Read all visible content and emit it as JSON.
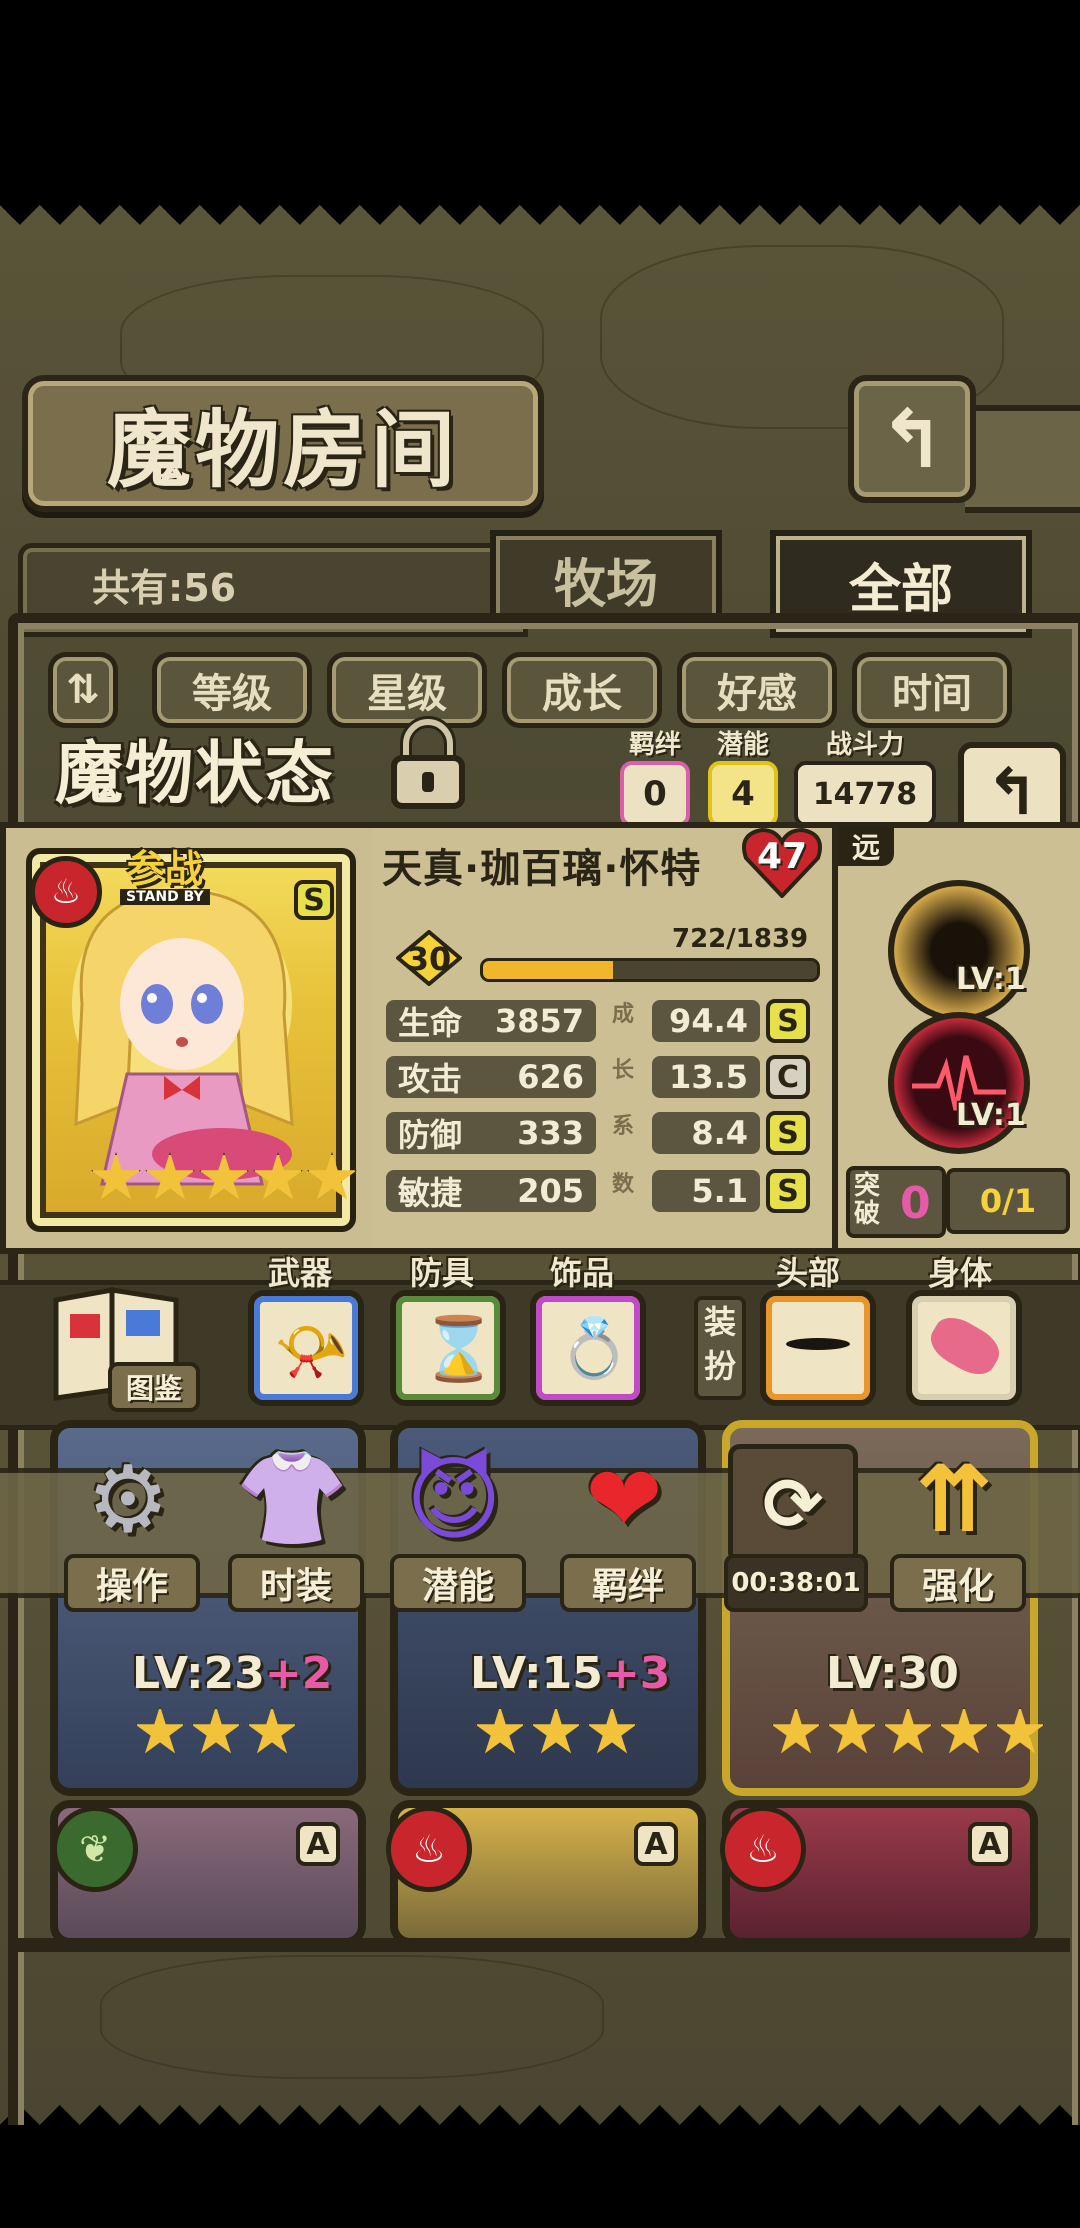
{
  "header": {
    "title": "魔物房间",
    "back_icon": "return-arrow-icon"
  },
  "collection": {
    "count_text": "共有:56"
  },
  "tabs": [
    {
      "label": "牧场"
    },
    {
      "label": "全部"
    }
  ],
  "sort_buttons": [
    {
      "label": "等级"
    },
    {
      "label": "星级"
    },
    {
      "label": "成长"
    },
    {
      "label": "好感"
    },
    {
      "label": "时间"
    }
  ],
  "status": {
    "title": "魔物状态",
    "bond_label": "羁绊",
    "bond_value": "0",
    "potential_label": "潜能",
    "potential_value": "4",
    "power_label": "战斗力",
    "power_value": "14778"
  },
  "monster": {
    "name": "天真·珈百璃·怀特",
    "badge_level": "47",
    "deploy_label": "参战",
    "deploy_sub": "STAND BY",
    "rank": "S",
    "level": "30",
    "exp": "722/1839",
    "exp_fraction": 0.39,
    "stars": 5,
    "element": "fire",
    "growth_label": [
      "成",
      "长",
      "系",
      "数"
    ],
    "stats": [
      {
        "label": "生命",
        "value": "3857",
        "growth": "94.4",
        "grade": "S"
      },
      {
        "label": "攻击",
        "value": "626",
        "growth": "13.5",
        "grade": "C"
      },
      {
        "label": "防御",
        "value": "333",
        "growth": "8.4",
        "grade": "S"
      },
      {
        "label": "敏捷",
        "value": "205",
        "growth": "5.1",
        "grade": "S"
      }
    ],
    "range_label": "远",
    "skills": [
      {
        "level": "LV:1"
      },
      {
        "level": "LV:1"
      }
    ],
    "breakthrough_label": "突破",
    "breakthrough_value": "0",
    "breakthrough_progress": "0/1"
  },
  "equipment": {
    "book_label": "图鉴",
    "slots": [
      {
        "label": "武器",
        "color": "#4a7ad8"
      },
      {
        "label": "防具",
        "color": "#5a8a3c"
      },
      {
        "label": "饰品",
        "color": "#c04ac8"
      }
    ],
    "dress_label": "装扮",
    "dress_slots": [
      {
        "label": "头部",
        "color": "#e8962a"
      },
      {
        "label": "身体",
        "color": "#d8cfb0"
      }
    ]
  },
  "actions": [
    {
      "label": "操作",
      "icon": "gear-icon"
    },
    {
      "label": "时装",
      "icon": "costume-icon"
    },
    {
      "label": "潜能",
      "icon": "demon-icon"
    },
    {
      "label": "羁绊",
      "icon": "hearts-icon"
    },
    {
      "label": "00:38:01",
      "icon": "refresh-icon"
    },
    {
      "label": "强化",
      "icon": "upgrade-arrows-icon"
    }
  ],
  "monster_cards": [
    {
      "lv": "LV:23",
      "plus": "+2",
      "stars": 3
    },
    {
      "lv": "LV:15",
      "plus": "+3",
      "stars": 3
    },
    {
      "lv": "LV:30",
      "plus": "",
      "stars": 5
    }
  ],
  "bottom_cards": [
    {
      "element": "leaf",
      "rank": "A"
    },
    {
      "element": "fire",
      "rank": "A"
    },
    {
      "element": "fire",
      "rank": "A"
    }
  ]
}
